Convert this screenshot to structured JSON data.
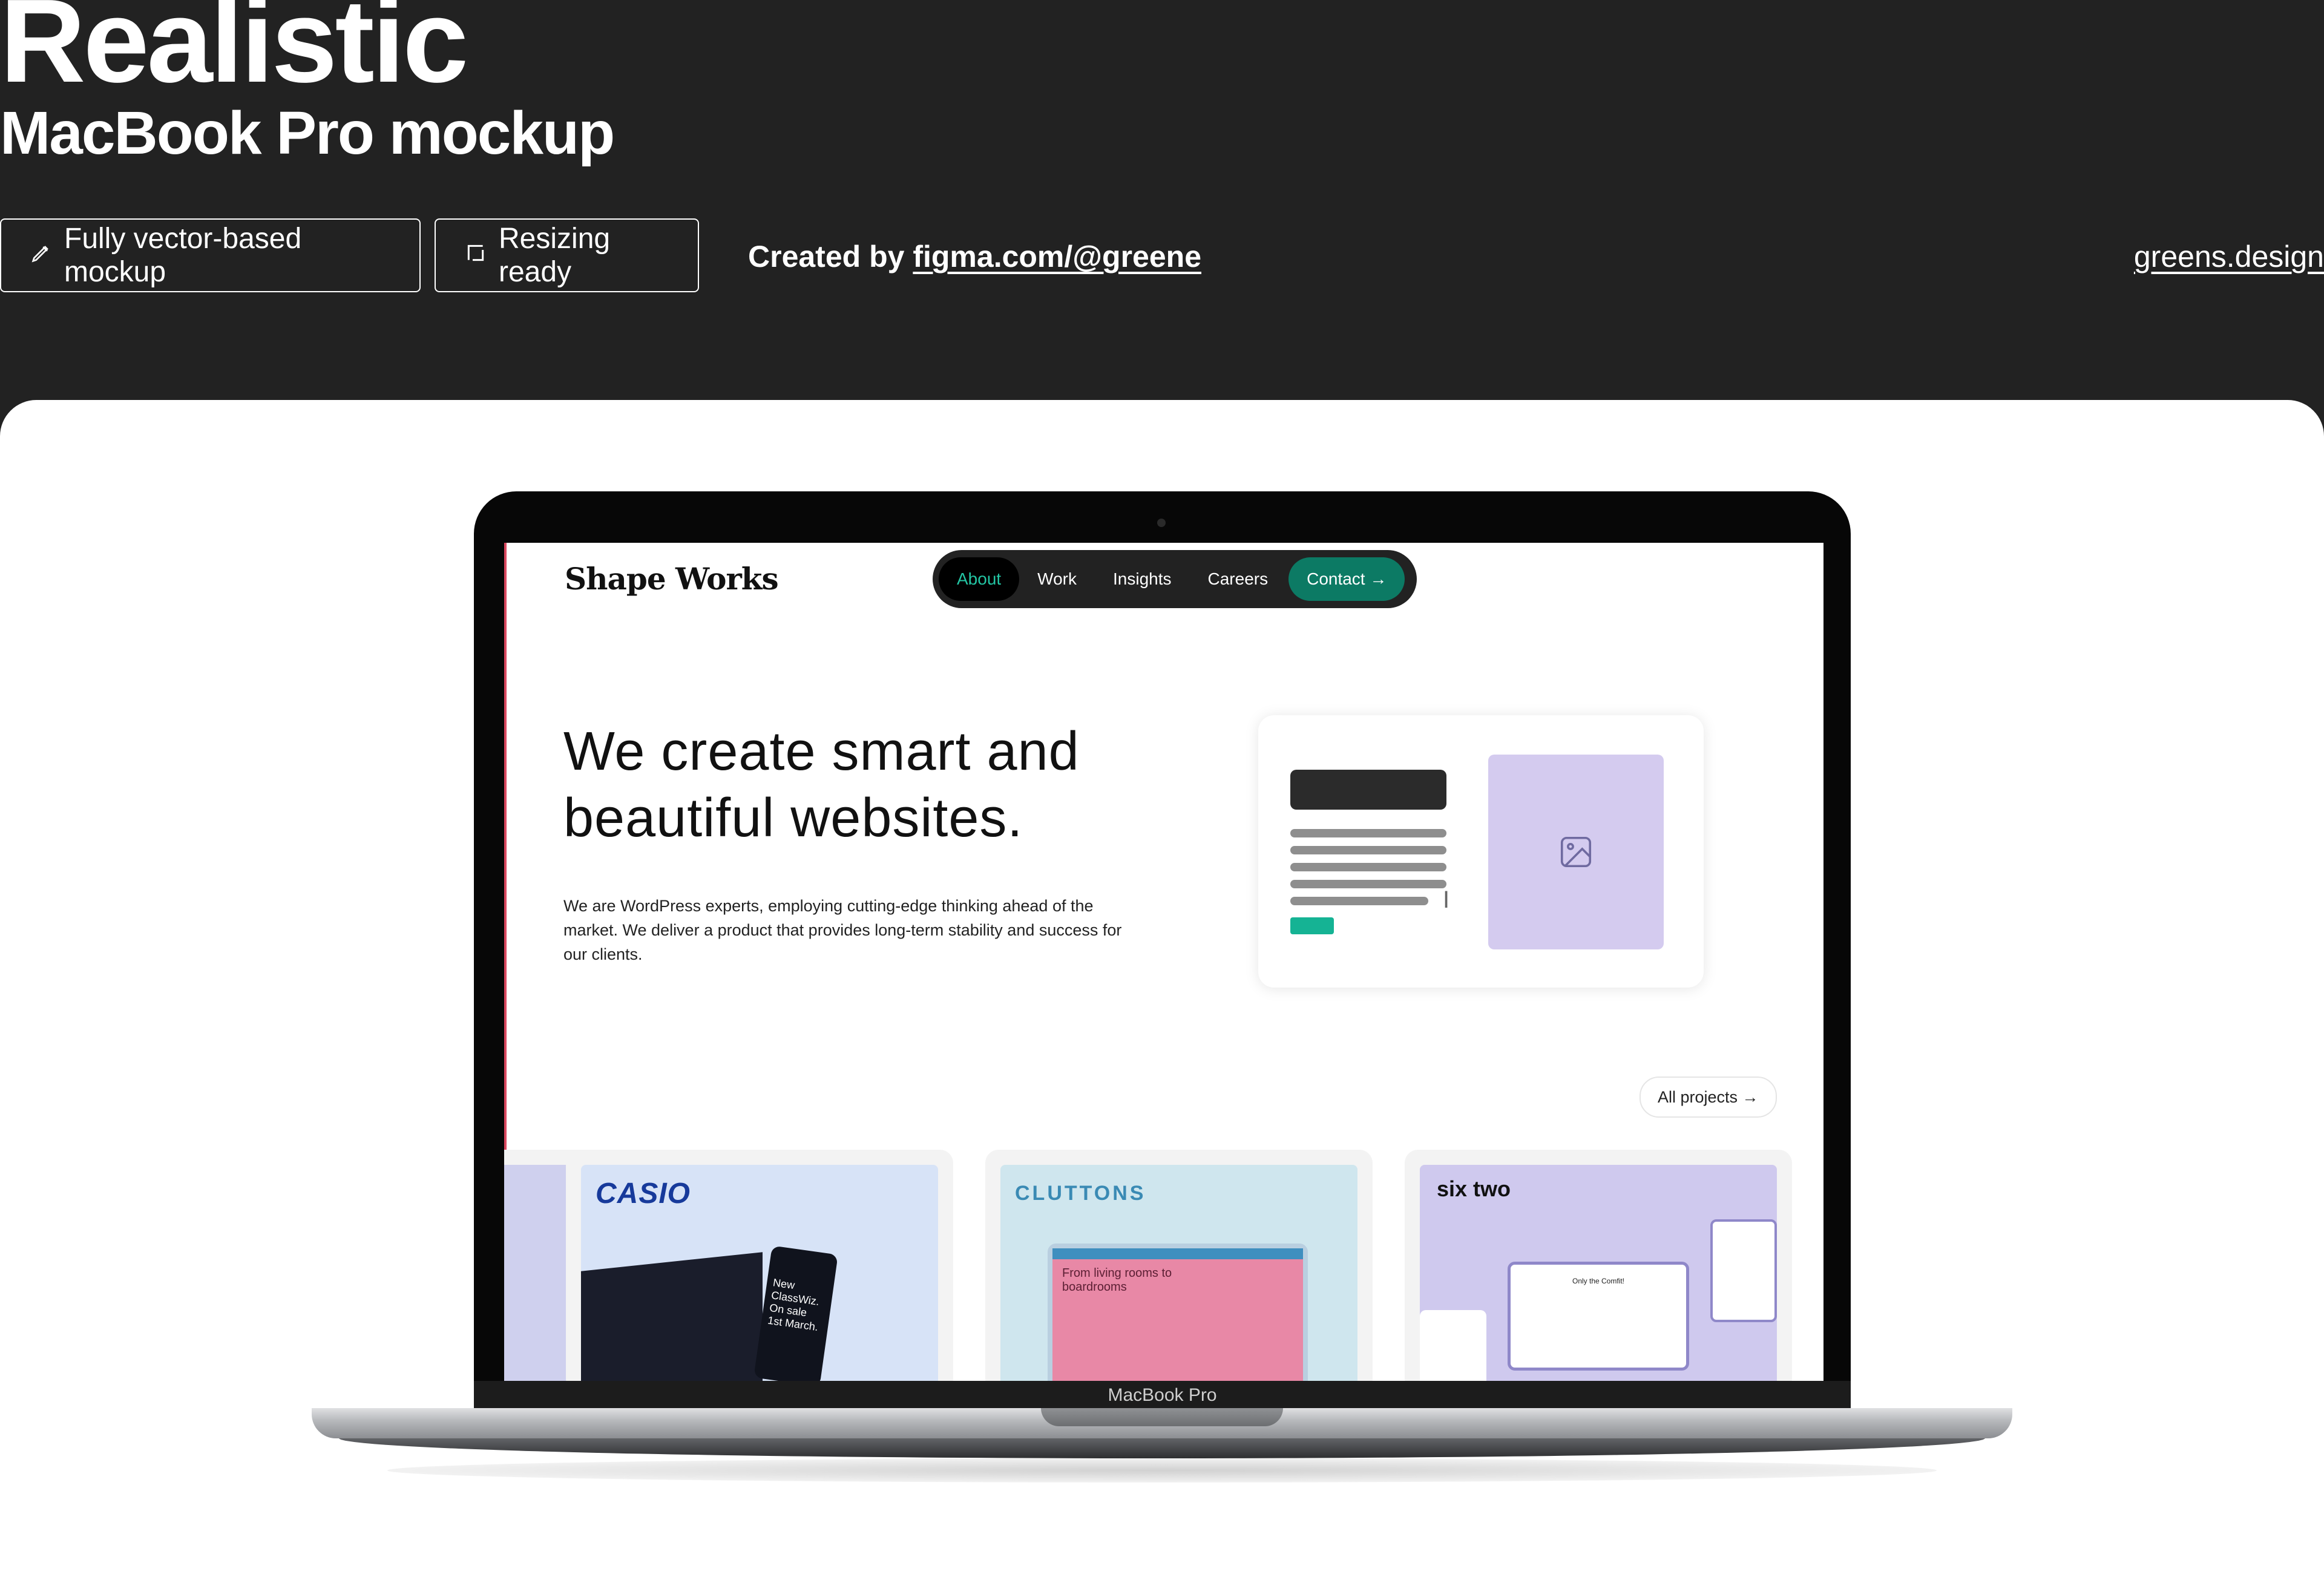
{
  "header": {
    "title": "Realistic",
    "subtitle": "MacBook Pro mockup",
    "badges": [
      {
        "label": "Fully vector-based mockup",
        "icon": "pen-icon"
      },
      {
        "label": "Resizing ready",
        "icon": "resize-icon"
      }
    ],
    "credit_prefix": "Created by",
    "credit_link": "figma.com/@greene",
    "site_link": "greens.design"
  },
  "device": {
    "label": "MacBook Pro"
  },
  "website": {
    "logo": "Shape Works",
    "nav": [
      "About",
      "Work",
      "Insights",
      "Careers",
      "Contact →"
    ],
    "active_nav": "About",
    "hero_line1": "We create smart and",
    "hero_line2": "beautiful websites.",
    "intro": "We are WordPress experts, employing cutting-edge thinking ahead of the market. We deliver a product that provides long-term stability and success for our clients.",
    "all_projects": "All projects →",
    "projects": [
      {
        "brand": "CASIO",
        "tagline": "New ClassWiz. On sale 1st March."
      },
      {
        "brand": "CLUTTONS",
        "tagline": "From living rooms to boardrooms"
      },
      {
        "brand": "six two",
        "tagline": "Only the Comfit!"
      }
    ]
  },
  "colors": {
    "page_bg": "#222222",
    "stage_bg": "#ffffff",
    "accent_teal": "#0c7a64",
    "active_nav_text": "#23c6a4",
    "placeholder_purple": "#d4cbef"
  }
}
